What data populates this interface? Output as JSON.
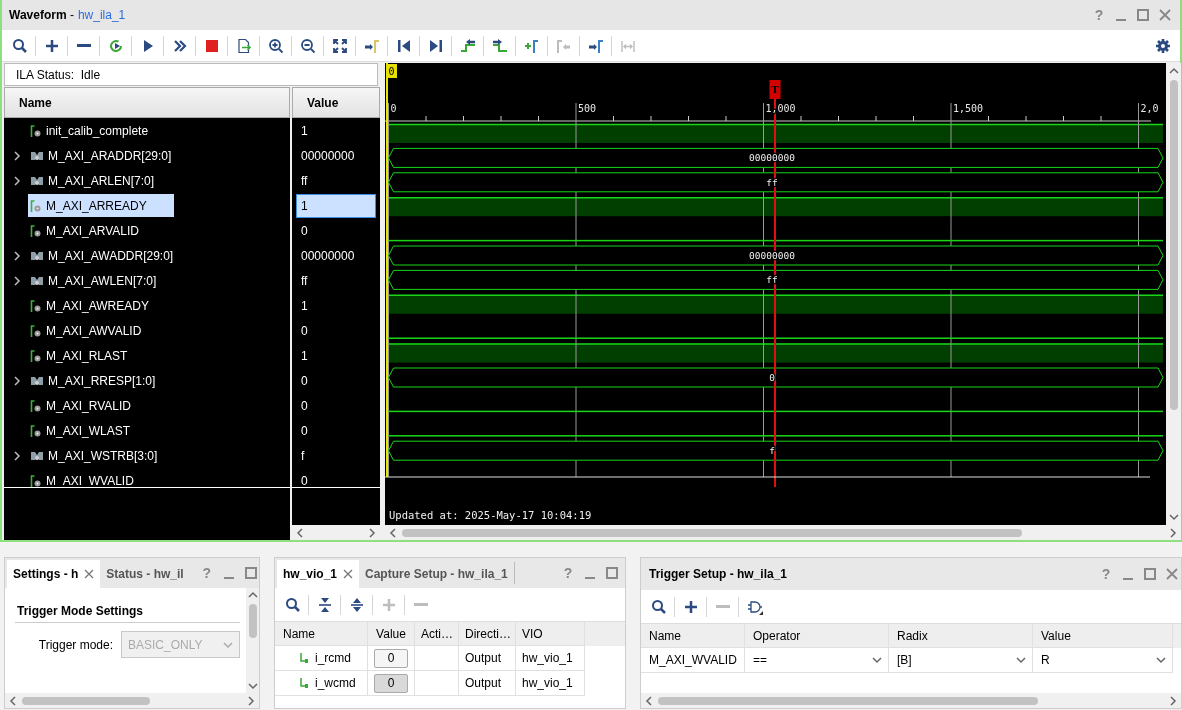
{
  "waveform": {
    "title": "**Waveform** -",
    "link": "hw_ila_1",
    "help": "?",
    "toolbar": [
      {
        "disabled": false
      },
      {
        "disabled": false
      },
      {
        "disabled": false
      },
      {
        "disabled": false
      },
      {
        "disabled": false
      },
      {
        "disabled": false
      },
      {
        "disabled": false
      },
      {
        "disabled": false
      },
      {
        "disabled": false
      },
      {
        "disabled": false
      },
      {
        "disabled": false
      },
      {
        "disabled": false
      },
      {
        "disabled": false
      },
      {
        "disabled": false
      },
      {
        "disabled": false
      },
      {
        "disabled": false
      },
      {
        "disabled": false
      },
      {
        "disabled": true
      },
      {
        "disabled": false
      },
      {
        "disabled": true
      }
    ],
    "ila_status": "ILA Status:  Idle",
    "columns": [
      "Name",
      "Value"
    ],
    "signals": [
      {
        "name": "init_calib_complete",
        "kind": "bit",
        "value": "1",
        "high": true,
        "selected": false
      },
      {
        "name": "M_AXI_ARADDR[29:0]",
        "kind": "bus",
        "value": "00000000",
        "wave_label": "00000000",
        "expanded": false,
        "selected": false
      },
      {
        "name": "M_AXI_ARLEN[7:0]",
        "kind": "bus",
        "value": "ff",
        "wave_label": "ff",
        "expanded": false,
        "selected": false
      },
      {
        "name": "M_AXI_ARREADY",
        "kind": "bit",
        "value": "1",
        "high": true,
        "selected": true
      },
      {
        "name": "M_AXI_ARVALID",
        "kind": "bit",
        "value": "0",
        "high": false,
        "selected": false
      },
      {
        "name": "M_AXI_AWADDR[29:0]",
        "kind": "bus",
        "value": "00000000",
        "wave_label": "00000000",
        "expanded": false,
        "selected": false
      },
      {
        "name": "M_AXI_AWLEN[7:0]",
        "kind": "bus",
        "value": "ff",
        "wave_label": "ff",
        "expanded": false,
        "selected": false
      },
      {
        "name": "M_AXI_AWREADY",
        "kind": "bit",
        "value": "1",
        "high": true,
        "selected": false
      },
      {
        "name": "M_AXI_AWVALID",
        "kind": "bit",
        "value": "0",
        "high": false,
        "selected": false
      },
      {
        "name": "M_AXI_RLAST",
        "kind": "bit",
        "value": "1",
        "high": true,
        "selected": false
      },
      {
        "name": "M_AXI_RRESP[1:0]",
        "kind": "bus",
        "value": "0",
        "wave_label": "0",
        "expanded": false,
        "selected": false
      },
      {
        "name": "M_AXI_RVALID",
        "kind": "bit",
        "value": "0",
        "high": false,
        "selected": false
      },
      {
        "name": "M_AXI_WLAST",
        "kind": "bit",
        "value": "0",
        "high": false,
        "selected": false
      },
      {
        "name": "M_AXI_WSTRB[3:0]",
        "kind": "bus",
        "value": "f",
        "wave_label": "f",
        "expanded": false,
        "selected": false
      },
      {
        "name": "M_AXI_WVALID",
        "kind": "bit",
        "value": "0",
        "selected": false
      }
    ],
    "ruler": {
      "ticks": [
        "0",
        "500",
        "1,000",
        "1,500",
        "2,0"
      ],
      "origin_marker": "0",
      "trigger_marker": "T"
    },
    "updated": "Updated at: 2025-May-17 10:04:19"
  },
  "settings_panel": {
    "tabs": [
      {
        "label": "Settings - h",
        "selected": true
      },
      {
        "label": "Status - hw_il",
        "selected": false
      }
    ],
    "help": "?",
    "section": "Trigger Mode Settings",
    "field_label": "Trigger mode:",
    "select": {
      "value": "BASIC_ONLY",
      "disabled": true
    }
  },
  "vio_panel": {
    "tabs": [
      {
        "label": "hw_vio_1",
        "selected": true
      },
      {
        "label": "Capture Setup - hw_ila_1",
        "selected": false
      }
    ],
    "help": "?",
    "toolbar": [
      {
        "disabled": false
      },
      {
        "disabled": false
      },
      {
        "disabled": false
      },
      {
        "disabled": true
      },
      {
        "disabled": true
      }
    ],
    "columns": [
      "Name",
      "Value",
      "Acti…",
      "Directi…",
      "VIO"
    ],
    "rows": [
      {
        "name": "i_rcmd",
        "value": "0",
        "pressed": false,
        "direction": "Output",
        "vio": "hw_vio_1"
      },
      {
        "name": "i_wcmd",
        "value": "0",
        "pressed": true,
        "direction": "Output",
        "vio": "hw_vio_1"
      }
    ]
  },
  "trigger_panel": {
    "title": "Trigger Setup - hw_ila_1",
    "help": "?",
    "toolbar": [
      {
        "disabled": false
      },
      {
        "disabled": false
      },
      {
        "disabled": true
      },
      {
        "disabled": false
      }
    ],
    "columns": [
      "Name",
      "Operator",
      "Radix",
      "Value"
    ],
    "rows": [
      {
        "name": "M_AXI_WVALID",
        "operator": "==",
        "radix": "[B]",
        "value": "R"
      }
    ]
  }
}
